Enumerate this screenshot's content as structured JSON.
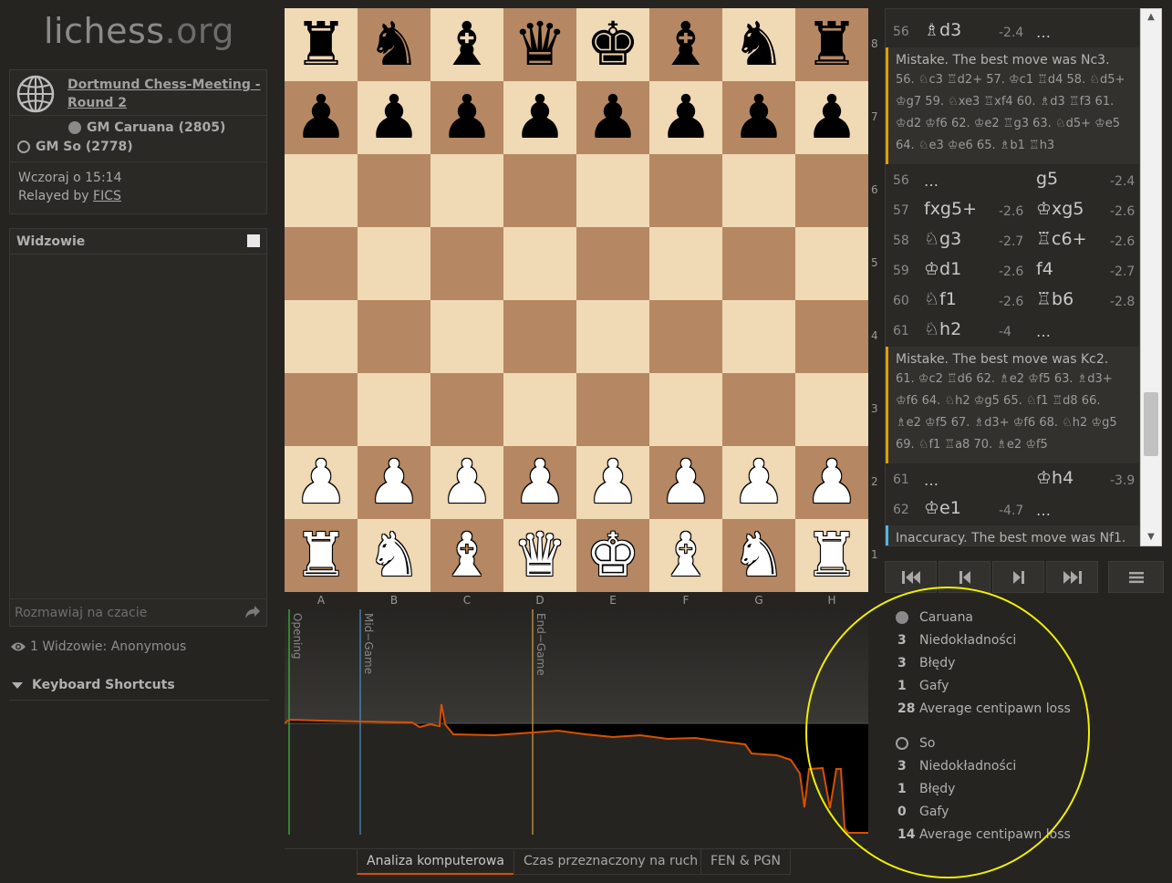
{
  "site": {
    "name": "lichess",
    "tld": ".org"
  },
  "game_info": {
    "title": "Dortmund Chess-Meeting - Round 2",
    "white_player": "GM Caruana (2805)",
    "black_player": "GM So (2778)",
    "date": "Wczoraj o 15:14",
    "relay_prefix": "Relayed by ",
    "relay_link": "FICS"
  },
  "spectators": {
    "title": "Widzowie",
    "chat_placeholder": "Rozmawiaj na czacie",
    "count_text": "1 Widzowie: Anonymous"
  },
  "shortcuts_label": "Keyboard Shortcuts",
  "board": {
    "ranks": [
      "8",
      "7",
      "6",
      "5",
      "4",
      "3",
      "2",
      "1"
    ],
    "files": [
      "A",
      "B",
      "C",
      "D",
      "E",
      "F",
      "G",
      "H"
    ],
    "pieces": [
      [
        "♜",
        "♞",
        "♝",
        "♛",
        "♚",
        "♝",
        "♞",
        "♜"
      ],
      [
        "♟",
        "♟",
        "♟",
        "♟",
        "♟",
        "♟",
        "♟",
        "♟"
      ],
      [
        "",
        "",
        "",
        "",
        "",
        "",
        "",
        ""
      ],
      [
        "",
        "",
        "",
        "",
        "",
        "",
        "",
        ""
      ],
      [
        "",
        "",
        "",
        "",
        "",
        "",
        "",
        ""
      ],
      [
        "",
        "",
        "",
        "",
        "",
        "",
        "",
        ""
      ],
      [
        "♟",
        "♟",
        "♟",
        "♟",
        "♟",
        "♟",
        "♟",
        "♟"
      ],
      [
        "♜",
        "♞",
        "♝",
        "♛",
        "♚",
        "♝",
        "♞",
        "♜"
      ]
    ]
  },
  "chart": {
    "labels": [
      "Opening",
      "Mid−Game",
      "End−Game"
    ],
    "colors": {
      "opening": "#3fbf3f",
      "midgame": "#4a90c8",
      "endgame": "#d4a24a",
      "line": "#d85000"
    }
  },
  "tabs": [
    "Analiza komputerowa",
    "Czas przeznaczony na ruch",
    "FEN & PGN"
  ],
  "moves": {
    "rows": [
      {
        "num": "56",
        "m1": "♗d3",
        "e1": "-2.4",
        "m2": "…",
        "e2": ""
      },
      {
        "num": "56",
        "m1": "…",
        "e1": "",
        "m2": "g5",
        "e2": "-2.4"
      },
      {
        "num": "57",
        "m1": "fxg5+",
        "e1": "-2.6",
        "m2": "♔xg5",
        "e2": "-2.6"
      },
      {
        "num": "58",
        "m1": "♘g3",
        "e1": "-2.7",
        "m2": "♖c6+",
        "e2": "-2.6"
      },
      {
        "num": "59",
        "m1": "♔d1",
        "e1": "-2.6",
        "m2": "f4",
        "e2": "-2.7"
      },
      {
        "num": "60",
        "m1": "♘f1",
        "e1": "-2.6",
        "m2": "♖b6",
        "e2": "-2.8"
      },
      {
        "num": "61",
        "m1": "♘h2",
        "e1": "-4",
        "m2": "…",
        "e2": ""
      },
      {
        "num": "61",
        "m1": "…",
        "e1": "",
        "m2": "♔h4",
        "e2": "-3.9"
      },
      {
        "num": "62",
        "m1": "♔e1",
        "e1": "-4.7",
        "m2": "…",
        "e2": ""
      }
    ],
    "comments": [
      {
        "head": "Mistake. The best move was Nc3.",
        "lines": [
          "56. ♘c3  ♖d2+  57. ♔c1  ♖d4  58. ♘d5+",
          "♔g7  59. ♘xe3  ♖xf4  60. ♗d3  ♖f3  61.",
          "♔d2  ♔f6  62. ♔e2  ♖g3  63. ♘d5+  ♔e5",
          "64. ♘e3  ♔e6  65. ♗b1  ♖h3"
        ]
      },
      {
        "head": "Mistake. The best move was Kc2.",
        "lines": [
          "61. ♔c2  ♖d6  62. ♗e2  ♔f5  63. ♗d3+",
          "♔f6  64. ♘h2  ♔g5  65. ♘f1  ♖d8  66.",
          "♗e2  ♔f5  67. ♗d3+  ♔f6  68. ♘h2  ♔g5",
          "69. ♘f1  ♖a8  70. ♗e2  ♔f5"
        ]
      },
      {
        "head": "Inaccuracy. The best move was Nf1.",
        "lines": []
      }
    ]
  },
  "stats": {
    "white": {
      "name": "Caruana",
      "rows": [
        {
          "n": "3",
          "label": "Niedokładności"
        },
        {
          "n": "3",
          "label": "Błędy"
        },
        {
          "n": "1",
          "label": "Gafy"
        },
        {
          "n": "28",
          "label": "Average centipawn loss"
        }
      ]
    },
    "black": {
      "name": "So",
      "rows": [
        {
          "n": "3",
          "label": "Niedokładności"
        },
        {
          "n": "1",
          "label": "Błędy"
        },
        {
          "n": "0",
          "label": "Gafy"
        },
        {
          "n": "14",
          "label": "Average centipawn loss"
        }
      ]
    }
  },
  "annotation_color": "#f0f000"
}
